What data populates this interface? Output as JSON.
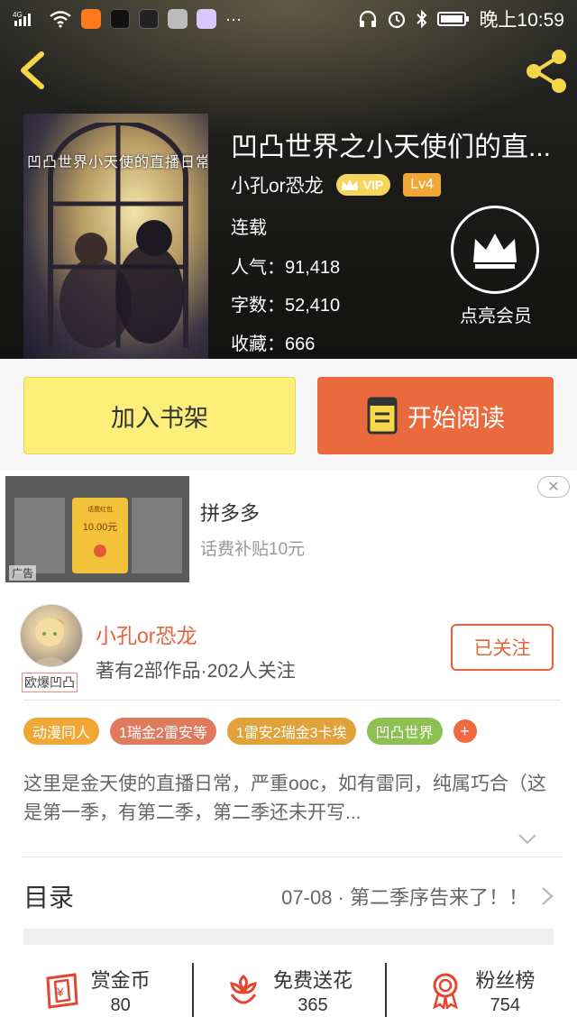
{
  "status_bar": {
    "network": "4G",
    "time": "晚上10:59"
  },
  "book": {
    "cover_text": "凹凸世界小天使的直播日常",
    "title": "凹凸世界之小天使们的直...",
    "author": "小孔or恐龙",
    "vip_label": "VIP",
    "level": "Lv4",
    "status": "连载",
    "popularity": "人气：91,418",
    "word_count": "字数：52,410",
    "favorites": "收藏：666",
    "vip_member_label": "点亮会员"
  },
  "actions": {
    "add_shelf": "加入书架",
    "start_reading": "开始阅读"
  },
  "ad": {
    "card_title": "话费红包",
    "card_amount": "10.00元",
    "tag": "广告",
    "name": "拼多多",
    "desc": "话费补贴10元",
    "close": "✕"
  },
  "author_card": {
    "avatar_tag": "欧爆凹凸",
    "name": "小孔or恐龙",
    "stats": "著有2部作品·202人关注",
    "follow_label": "已关注"
  },
  "tags": [
    {
      "label": "动漫同人",
      "color": "#f0a735"
    },
    {
      "label": "1瑞金2雷安等",
      "color": "#e07a5f"
    },
    {
      "label": "1雷安2瑞金3卡埃",
      "color": "#e2a23a"
    },
    {
      "label": "凹凸世界",
      "color": "#8cc152"
    }
  ],
  "tags_plus": "+",
  "description": "这里是金天使的直播日常，严重ooc，如有雷同，纯属巧合（这是第一季，有第二季，第二季还未开写...",
  "toc": {
    "title": "目录",
    "latest": "07-08 · 第二季序告来了！！"
  },
  "bottom_bar": [
    {
      "label": "赏金币",
      "count": "80",
      "icon": "coin-envelope-icon"
    },
    {
      "label": "免费送花",
      "count": "365",
      "icon": "flower-icon"
    },
    {
      "label": "粉丝榜",
      "count": "754",
      "icon": "medal-icon"
    }
  ],
  "colors": {
    "accent": "#ea6a3e",
    "shelf_yellow": "#fbef7a",
    "author_orange": "#e4633a"
  }
}
